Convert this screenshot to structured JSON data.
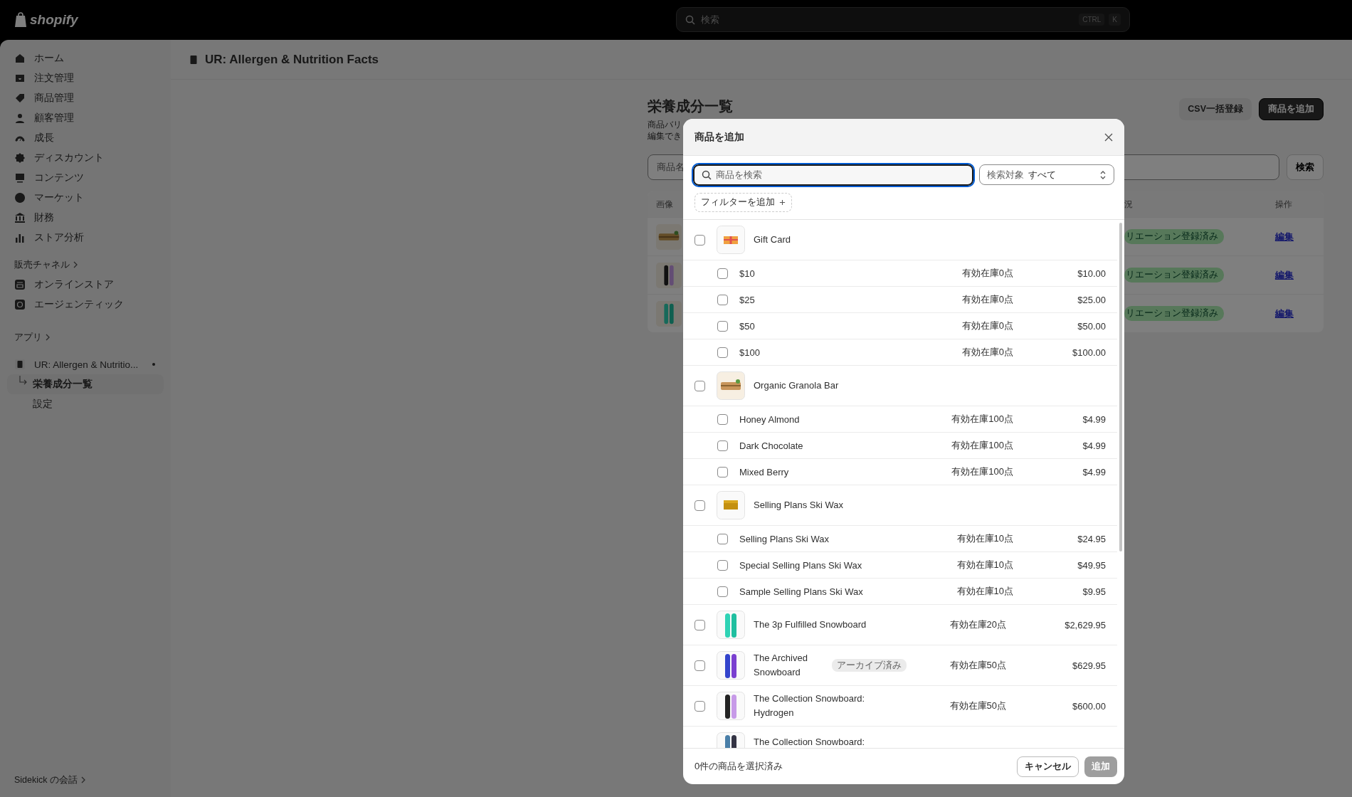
{
  "topbar": {
    "logo": "shopify",
    "search": {
      "placeholder": "検索"
    },
    "shortcut": [
      "CTRL",
      "K"
    ]
  },
  "sidebar": {
    "items": [
      {
        "label": "ホーム"
      },
      {
        "label": "注文管理"
      },
      {
        "label": "商品管理"
      },
      {
        "label": "顧客管理"
      },
      {
        "label": "成長"
      },
      {
        "label": "ディスカウント"
      },
      {
        "label": "コンテンツ"
      },
      {
        "label": "マーケット"
      },
      {
        "label": "財務"
      },
      {
        "label": "ストア分析"
      }
    ],
    "sales_channels": {
      "heading": "販売チャネル",
      "items": [
        {
          "label": "オンラインストア"
        },
        {
          "label": "エージェンティック"
        }
      ]
    },
    "apps": {
      "heading": "アプリ",
      "app": {
        "label": "UR: Allergen & Nutritio...",
        "children": [
          {
            "label": "栄養成分一覧",
            "selected": true
          },
          {
            "label": "設定",
            "selected": false
          }
        ]
      }
    },
    "sidekick": "Sidekick の会話"
  },
  "page": {
    "app_title": "UR: Allergen & Nutrition Facts",
    "heading": "栄養成分一覧",
    "description": [
      "商品バリ",
      "編集でき"
    ],
    "buttons": [
      {
        "label": "CSV一括登録",
        "kind": "secondary"
      },
      {
        "label": "商品を追加",
        "kind": "primary"
      }
    ],
    "search": {
      "placeholder": "商品名",
      "button": "検索"
    },
    "table": {
      "columns": [
        "画像",
        "況",
        "操作"
      ],
      "rows": [
        {
          "status": "リエーション登録済み",
          "action": "編集"
        },
        {
          "status": "リエーション登録済み",
          "action": "編集"
        },
        {
          "status": "リエーション登録済み",
          "action": "編集"
        }
      ]
    }
  },
  "modal": {
    "title": "商品を追加",
    "search": {
      "placeholder": "商品を検索"
    },
    "scope": {
      "label": "検索対象",
      "value": "すべて"
    },
    "filter_button": "フィルターを追加",
    "products": [
      {
        "name": "Gift Card",
        "checked": false,
        "variants": [
          {
            "name": "$10",
            "checked": false,
            "stock": "有効在庫0点",
            "price": "$10.00"
          },
          {
            "name": "$25",
            "checked": false,
            "stock": "有効在庫0点",
            "price": "$25.00"
          },
          {
            "name": "$50",
            "checked": false,
            "stock": "有効在庫0点",
            "price": "$50.00"
          },
          {
            "name": "$100",
            "checked": false,
            "stock": "有効在庫0点",
            "price": "$100.00"
          }
        ]
      },
      {
        "name": "Organic Granola Bar",
        "checked": false,
        "variants": [
          {
            "name": "Honey Almond",
            "checked": false,
            "stock": "有効在庫100点",
            "price": "$4.99"
          },
          {
            "name": "Dark Chocolate",
            "checked": false,
            "stock": "有効在庫100点",
            "price": "$4.99"
          },
          {
            "name": "Mixed Berry",
            "checked": false,
            "stock": "有効在庫100点",
            "price": "$4.99"
          }
        ]
      },
      {
        "name": "Selling Plans Ski Wax",
        "checked": false,
        "variants": [
          {
            "name": "Selling Plans Ski Wax",
            "checked": false,
            "stock": "有効在庫10点",
            "price": "$24.95"
          },
          {
            "name": "Special Selling Plans Ski Wax",
            "checked": false,
            "stock": "有効在庫10点",
            "price": "$49.95"
          },
          {
            "name": "Sample Selling Plans Ski Wax",
            "checked": false,
            "stock": "有効在庫10点",
            "price": "$9.95"
          }
        ]
      },
      {
        "name": "The 3p Fulfilled Snowboard",
        "checked": false,
        "stock": "有効在庫20点",
        "price": "$2,629.95"
      },
      {
        "name": "The Archived Snowboard",
        "checked": false,
        "badge": "アーカイブ済み",
        "stock": "有効在庫50点",
        "price": "$629.95"
      },
      {
        "name": "The Collection Snowboard: Hydrogen",
        "checked": false,
        "stock": "有効在庫50点",
        "price": "$600.00"
      },
      {
        "name": "The Collection Snowboard:"
      }
    ],
    "footer": {
      "selection": "0件の商品を選択済み",
      "cancel": "キャンセル",
      "add": {
        "label": "追加",
        "disabled": true
      }
    }
  }
}
